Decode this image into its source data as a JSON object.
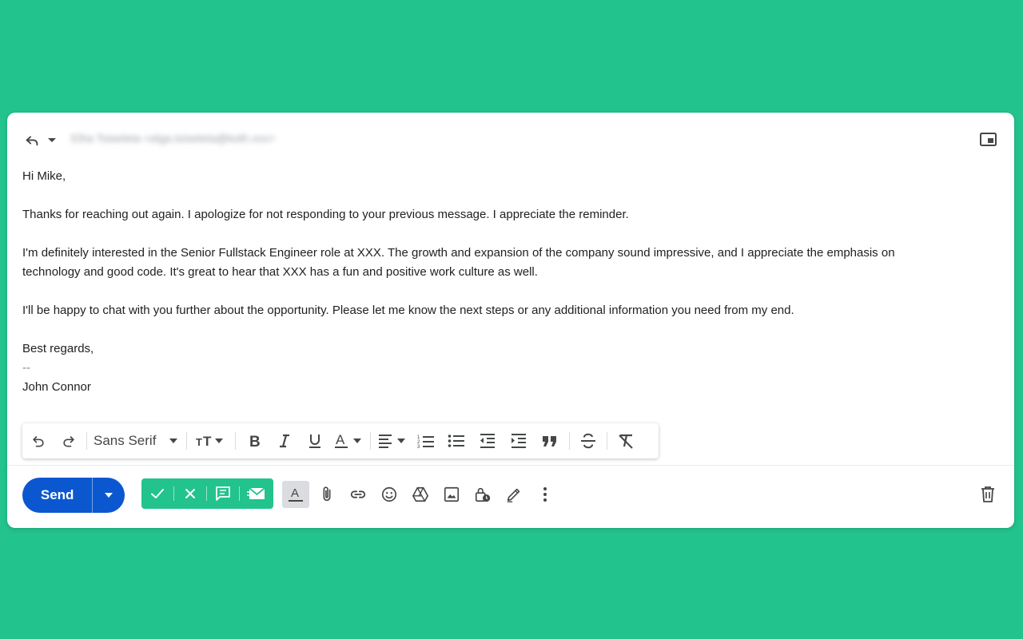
{
  "compose": {
    "recipient": "Elha Toiseleta <elga.toiseleta@koth.xxx>",
    "body": {
      "greeting": "Hi Mike,",
      "para1": "Thanks for reaching out again. I apologize for not responding to your previous message. I appreciate the reminder.",
      "para2a": "I'm definitely interested in the Senior Fullstack Engineer role at XXX. The growth and expansion of the company sound impressive, and I appreciate the emphasis on",
      "para2b": "technology and good code. It's great to hear that XXX has a fun and positive work culture as well.",
      "para3": "I'll be happy to chat with you further about the opportunity. Please let me know the next steps or any additional information you need from my end.",
      "closing": "Best regards,",
      "sig_sep": "--",
      "signature": "John Connor"
    }
  },
  "format_bar": {
    "font": "Sans Serif",
    "icons": [
      "undo-icon",
      "redo-icon",
      "font-size-icon",
      "bold-icon",
      "italic-icon",
      "underline-icon",
      "text-color-icon",
      "align-icon",
      "numbered-list-icon",
      "bulleted-list-icon",
      "indent-less-icon",
      "indent-more-icon",
      "quote-icon",
      "strikethrough-icon",
      "remove-formatting-icon"
    ]
  },
  "bottom_bar": {
    "send_label": "Send",
    "icons": [
      "formatting-options-icon",
      "attach-icon",
      "link-icon",
      "emoji-icon",
      "drive-icon",
      "photo-icon",
      "confidential-icon",
      "signature-icon",
      "more-options-icon",
      "trash-icon"
    ]
  },
  "colors": {
    "background": "#22c38d",
    "send": "#0b57d0",
    "extension_bar": "#22c38d"
  }
}
